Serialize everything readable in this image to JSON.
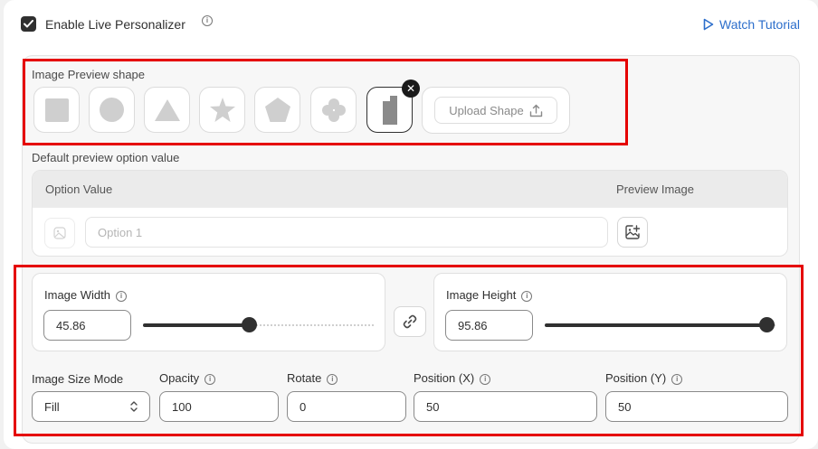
{
  "header": {
    "enable_label": "Enable Live Personalizer",
    "enable_checked": true,
    "tutorial_label": "Watch Tutorial",
    "accent_color": "#2c6ecb"
  },
  "shapes": {
    "section_label": "Image Preview shape",
    "items": [
      {
        "name": "square",
        "icon": "square-icon"
      },
      {
        "name": "circle",
        "icon": "circle-icon"
      },
      {
        "name": "triangle",
        "icon": "triangle-icon"
      },
      {
        "name": "star",
        "icon": "star-icon"
      },
      {
        "name": "pentagon",
        "icon": "pentagon-icon"
      },
      {
        "name": "flower",
        "icon": "flower-icon"
      },
      {
        "name": "custom",
        "icon": "custom-shape-icon",
        "selected": true
      }
    ],
    "upload_label": "Upload Shape"
  },
  "default_option": {
    "section_label": "Default preview option value",
    "col_option": "Option Value",
    "col_preview": "Preview Image",
    "option_placeholder": "Option 1"
  },
  "dimensions": {
    "width_label": "Image Width",
    "width_value": "45.86",
    "width_slider_fraction": 0.4586,
    "height_label": "Image Height",
    "height_value": "95.86",
    "height_slider_fraction": 0.9586
  },
  "fields": {
    "size_mode_label": "Image Size Mode",
    "size_mode_value": "Fill",
    "opacity_label": "Opacity",
    "opacity_value": "100",
    "rotate_label": "Rotate",
    "rotate_value": "0",
    "posx_label": "Position (X)",
    "posx_value": "50",
    "posy_label": "Position (Y)",
    "posy_value": "50"
  },
  "highlight_color": "#e50000"
}
